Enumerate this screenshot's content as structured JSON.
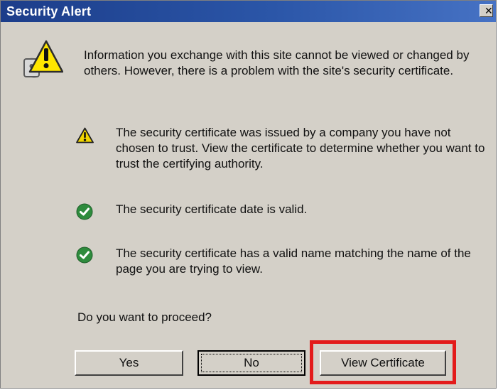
{
  "window": {
    "title": "Security Alert",
    "close_glyph": "✕"
  },
  "message": {
    "main": "Information you exchange with this site cannot be viewed or changed by others. However, there is a problem with the site's security certificate.",
    "question": "Do you want to proceed?"
  },
  "items": [
    {
      "icon": "warning-icon",
      "text": "The security certificate was issued by a company you have not chosen to trust. View the certificate to determine whether you want to trust the certifying authority."
    },
    {
      "icon": "check-icon",
      "text": "The security certificate date is valid."
    },
    {
      "icon": "check-icon",
      "text": "The security certificate has a valid name matching the name of the page you are trying to view."
    }
  ],
  "buttons": {
    "yes": "Yes",
    "no": "No",
    "view_certificate": "View Certificate"
  },
  "colors": {
    "dialog_background": "#d4d0c8",
    "title_bar": "#2b56a8",
    "highlight": "#e31b1b",
    "check": "#2e8b3d",
    "warning": "#f2d600"
  },
  "icons": {
    "security_alert": "lock-warning-icon",
    "warning": "warning-icon",
    "check": "check-icon"
  }
}
